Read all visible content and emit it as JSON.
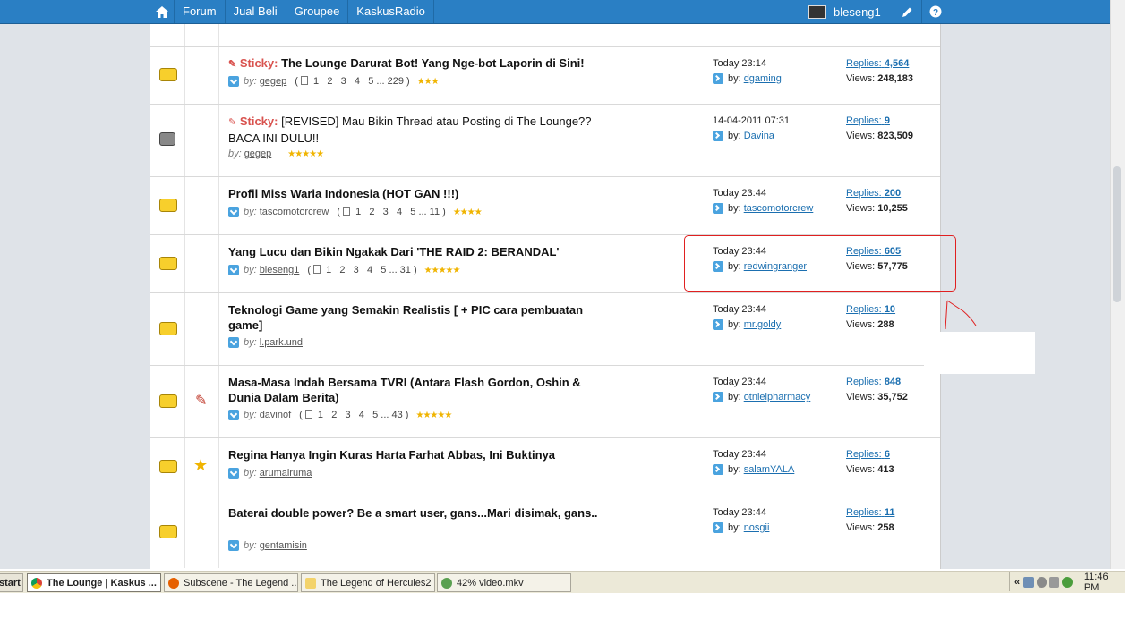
{
  "navbar": {
    "items": [
      "Forum",
      "Jual Beli",
      "Groupee",
      "KaskusRadio"
    ],
    "username": "bleseng1"
  },
  "threads": [
    {
      "sticky_label": "Sticky:",
      "title": "The Lounge Darurat Bot! Yang Nge-bot Laporin di Sini!",
      "by": "by:",
      "author": "gegep",
      "pages": [
        "1",
        "2",
        "3",
        "4",
        "5",
        "... 229"
      ],
      "stars": "★★★",
      "last_time": "Today 23:14",
      "last_by": "dgaming",
      "replies_label": "Replies:",
      "replies": "4,564",
      "views_label": "Views:",
      "views": "248,183"
    },
    {
      "sticky_label": "Sticky:",
      "title": "[REVISED] Mau Bikin Thread atau Posting di The Lounge?? BACA INI DULU!!",
      "by": "by:",
      "author": "gegep",
      "stars": "★★★★★",
      "last_time": "14-04-2011 07:31",
      "last_by": "Davina",
      "replies_label": "Replies:",
      "replies": "9",
      "views_label": "Views:",
      "views": "823,509"
    },
    {
      "title": "Profil Miss Waria Indonesia (HOT GAN !!!)",
      "by": "by:",
      "author": "tascomotorcrew",
      "pages": [
        "1",
        "2",
        "3",
        "4",
        "5",
        "... 11"
      ],
      "stars": "★★★★",
      "last_time": "Today 23:44",
      "last_by": "tascomotorcrew",
      "replies_label": "Replies:",
      "replies": "200",
      "views_label": "Views:",
      "views": "10,255"
    },
    {
      "title": "Yang Lucu dan Bikin Ngakak Dari 'THE RAID 2: BERANDAL'",
      "by": "by:",
      "author": "bleseng1",
      "pages": [
        "1",
        "2",
        "3",
        "4",
        "5",
        "... 31"
      ],
      "stars": "★★★★★",
      "last_time": "Today 23:44",
      "last_by": "redwingranger",
      "replies_label": "Replies:",
      "replies": "605",
      "views_label": "Views:",
      "views": "57,775"
    },
    {
      "title": "Teknologi Game yang Semakin Realistis [ + PIC cara pembuatan game]",
      "by": "by:",
      "author": "l.park.und",
      "last_time": "Today 23:44",
      "last_by": "mr.goldy",
      "replies_label": "Replies:",
      "replies": "10",
      "views_label": "Views:",
      "views": "288"
    },
    {
      "title": "Masa-Masa Indah Bersama TVRI (Antara Flash Gordon, Oshin & Dunia Dalam Berita)",
      "by": "by:",
      "author": "davinof",
      "pages": [
        "1",
        "2",
        "3",
        "4",
        "5",
        "... 43"
      ],
      "stars": "★★★★★",
      "last_time": "Today 23:44",
      "last_by": "otnielpharmacy",
      "replies_label": "Replies:",
      "replies": "848",
      "views_label": "Views:",
      "views": "35,752"
    },
    {
      "title": "Regina Hanya Ingin Kuras Harta Farhat Abbas, Ini Buktinya",
      "by": "by:",
      "author": "arumairuma",
      "last_time": "Today 23:44",
      "last_by": "salamYALA",
      "replies_label": "Replies:",
      "replies": "6",
      "views_label": "Views:",
      "views": "413"
    },
    {
      "title": "Baterai double power? Be a smart user, gans...Mari disimak, gans..",
      "by": "by:",
      "author": "gentamisin",
      "last_time": "Today 23:44",
      "last_by": "nosgii",
      "replies_label": "Replies:",
      "replies": "11",
      "views_label": "Views:",
      "views": "258"
    }
  ],
  "taskbar": {
    "start": "start",
    "items": [
      "The Lounge | Kaskus ...",
      "Subscene - The Legend ...",
      "The Legend of Hercules2",
      "42% video.mkv"
    ],
    "tray_arrows": "«",
    "clock": "11:46 PM"
  },
  "colors": {
    "topbar": "#2a7fc4",
    "link": "#1b6fb0",
    "sticky": "#d9534f",
    "star": "#f0b400",
    "annotation": "#e02020"
  }
}
